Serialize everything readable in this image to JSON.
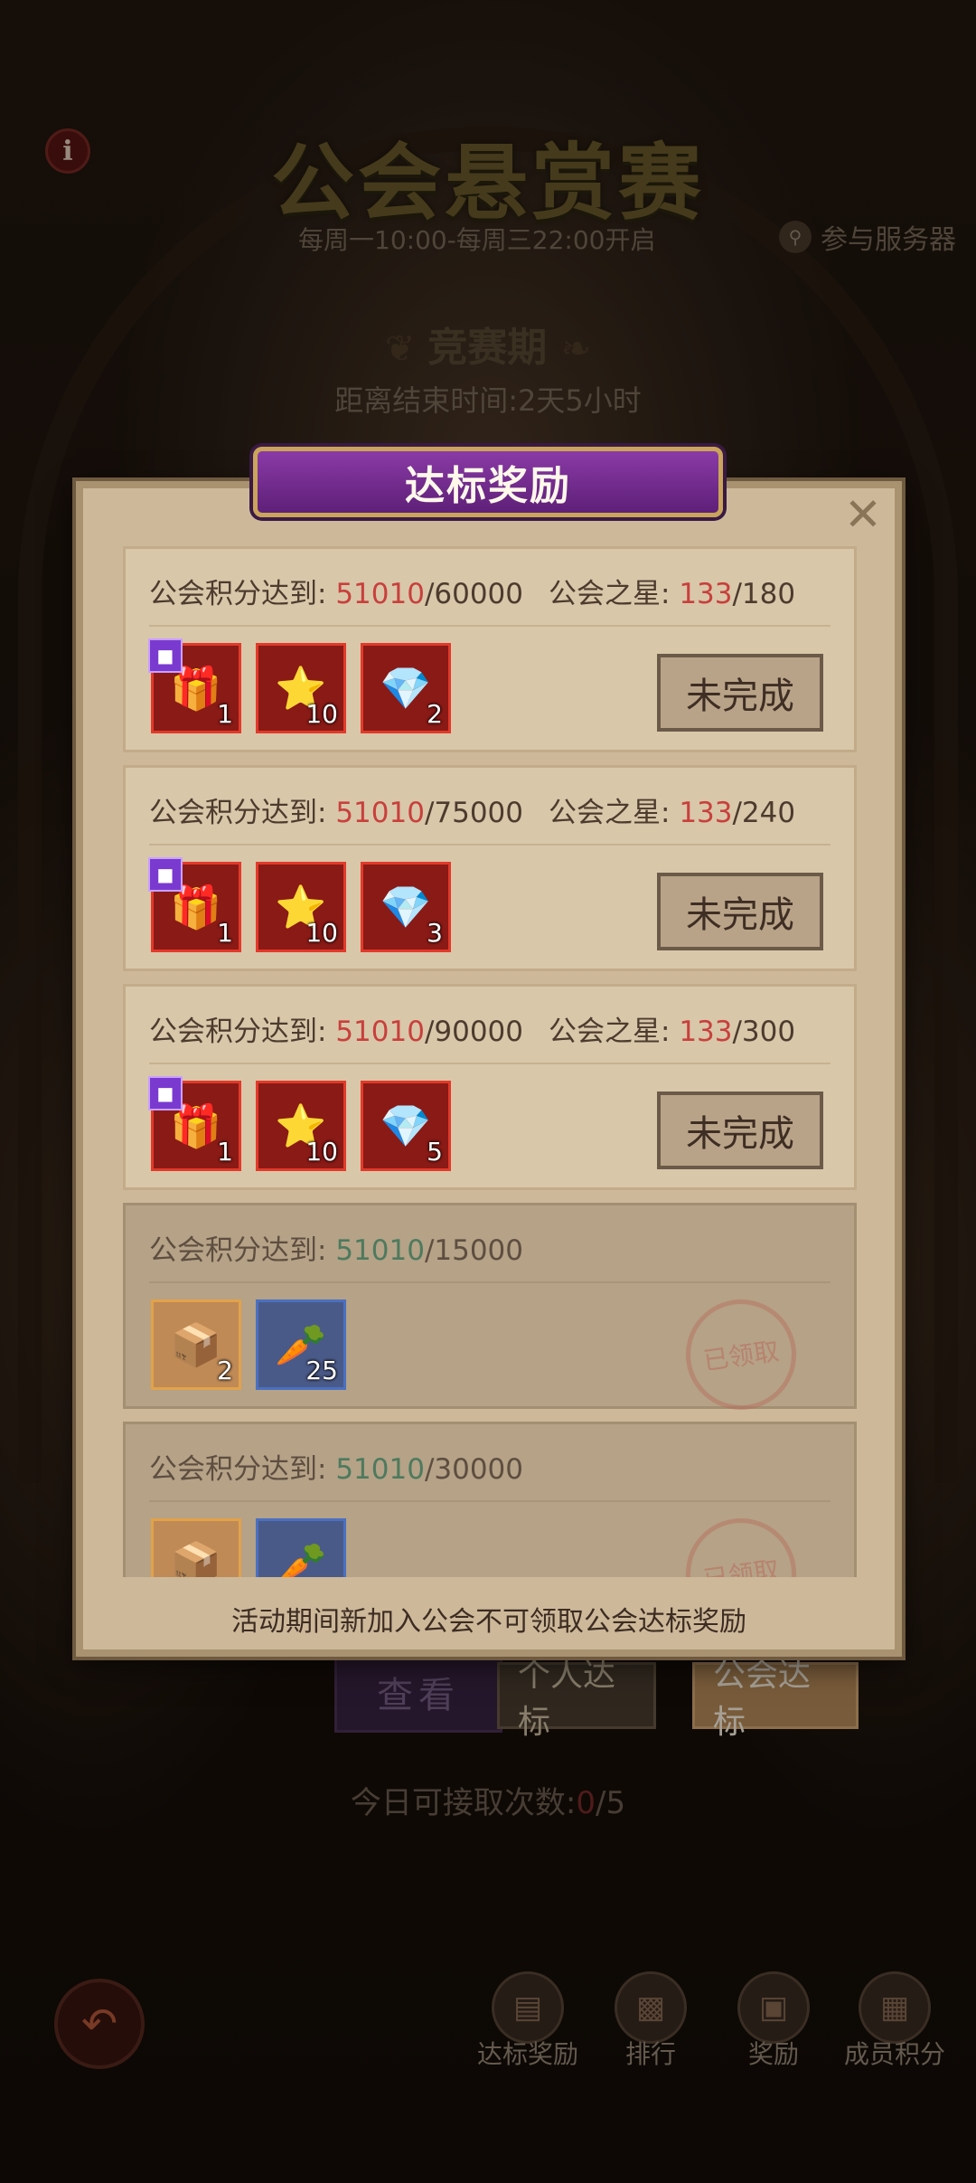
{
  "header": {
    "title": "公会悬赏赛",
    "subtitle": "每周一10:00-每周三22:00开启",
    "server_label": "参与服务器"
  },
  "phase": {
    "label": "竞赛期",
    "countdown": "距离结束时间:2天5小时"
  },
  "background_controls": {
    "view_label": "查看",
    "tab_personal": "个人达标",
    "tab_guild": "公会达标",
    "daily_prefix": "今日可接取次数:",
    "daily_used": "0",
    "daily_total": "/5"
  },
  "bottom_nav": [
    {
      "label": "达标奖励",
      "icon": "book-icon"
    },
    {
      "label": "排行",
      "icon": "ranking-icon"
    },
    {
      "label": "奖励",
      "icon": "chest-icon"
    },
    {
      "label": "成员积分",
      "icon": "scroll-icon"
    }
  ],
  "modal": {
    "title": "达标奖励",
    "footnote": "活动期间新加入公会不可领取公会达标奖励",
    "req_label": "公会积分达到:",
    "star_label": "公会之星:",
    "tiers": [
      {
        "points_current": "51010",
        "points_target": "/60000",
        "stars_current": "133",
        "stars_target": "/180",
        "status": "未完成",
        "rewards": [
          {
            "icon": "gift-chest-icon",
            "qty": "1"
          },
          {
            "icon": "star-icon",
            "qty": "10"
          },
          {
            "icon": "crystal-icon",
            "qty": "2"
          }
        ]
      },
      {
        "points_current": "51010",
        "points_target": "/75000",
        "stars_current": "133",
        "stars_target": "/240",
        "status": "未完成",
        "rewards": [
          {
            "icon": "gift-chest-icon",
            "qty": "1"
          },
          {
            "icon": "star-icon",
            "qty": "10"
          },
          {
            "icon": "crystal-icon",
            "qty": "3"
          }
        ]
      },
      {
        "points_current": "51010",
        "points_target": "/90000",
        "stars_current": "133",
        "stars_target": "/300",
        "status": "未完成",
        "rewards": [
          {
            "icon": "gift-chest-icon",
            "qty": "1"
          },
          {
            "icon": "star-icon",
            "qty": "10"
          },
          {
            "icon": "crystal-icon",
            "qty": "5"
          }
        ]
      },
      {
        "points_current": "51010",
        "points_target": "/15000",
        "status": "已领取",
        "rewards": [
          {
            "icon": "silver-chest-icon",
            "qty": "2"
          },
          {
            "icon": "carrot-icon",
            "qty": "25"
          }
        ]
      },
      {
        "points_current": "51010",
        "points_target": "/30000",
        "status": "已领取",
        "rewards": [
          {
            "icon": "silver-chest-icon",
            "qty": ""
          },
          {
            "icon": "golden-carrot-icon",
            "qty": ""
          }
        ]
      }
    ]
  },
  "colors": {
    "accent_red": "#c8403c",
    "accent_green": "#4e7a5e",
    "header_purple": "#7a2e96"
  }
}
